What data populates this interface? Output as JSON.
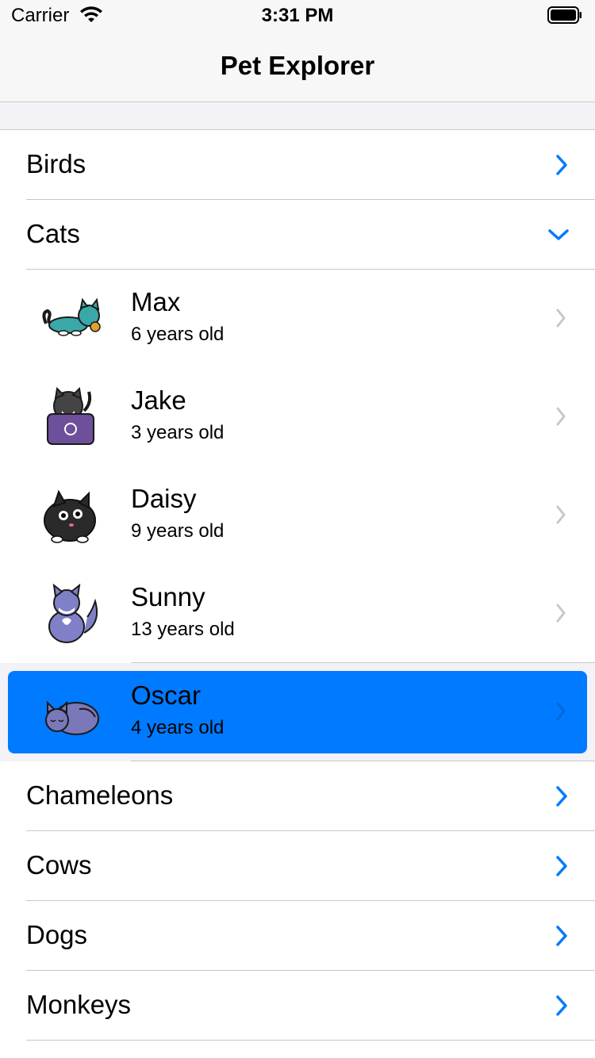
{
  "status_bar": {
    "carrier": "Carrier",
    "time": "3:31 PM"
  },
  "nav": {
    "title": "Pet Explorer"
  },
  "colors": {
    "accent": "#007aff",
    "separator": "#c8c7cc",
    "chevron_gray": "#c7c7cc",
    "selected": "#007aff"
  },
  "categories_top": [
    {
      "label": "Birds",
      "icon": "chevron-right-icon"
    }
  ],
  "expanded_category": {
    "label": "Cats",
    "icon": "chevron-down-icon"
  },
  "pets": [
    {
      "name": "Max",
      "age": "6 years old",
      "icon": "cat-max-image"
    },
    {
      "name": "Jake",
      "age": "3 years old",
      "icon": "cat-jake-image"
    },
    {
      "name": "Daisy",
      "age": "9 years old",
      "icon": "cat-daisy-image"
    },
    {
      "name": "Sunny",
      "age": "13 years old",
      "icon": "cat-sunny-image"
    },
    {
      "name": "Oscar",
      "age": "4 years old",
      "icon": "cat-oscar-image",
      "selected": true
    }
  ],
  "categories_bottom": [
    {
      "label": "Chameleons"
    },
    {
      "label": "Cows"
    },
    {
      "label": "Dogs"
    },
    {
      "label": "Monkeys"
    }
  ]
}
